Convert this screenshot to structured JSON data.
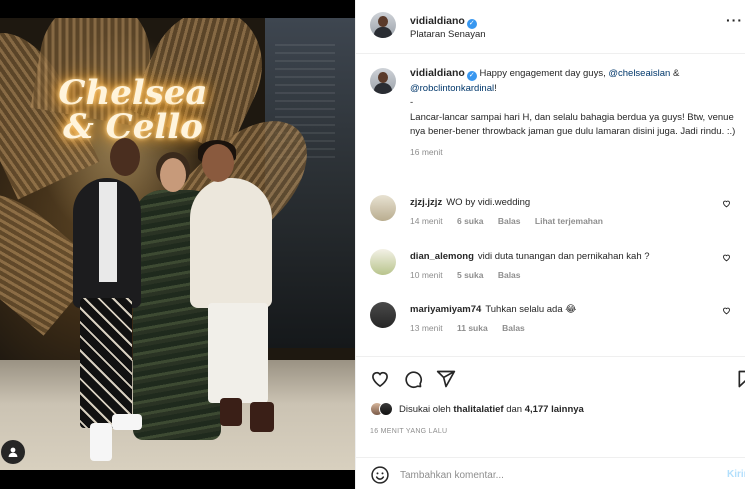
{
  "post": {
    "username": "vidialdiano",
    "location": "Plataran Senayan",
    "neon_sign": "Chelsea & Cello"
  },
  "caption": {
    "username": "vidialdiano",
    "text_1": "Happy engagement day guys,",
    "mention_1": "@chelseaislan",
    "amp": "&",
    "mention_2": "@robclintonkardinal",
    "text_2": "!",
    "dash": "-",
    "body": "Lancar-lancar sampai hari H, dan selalu bahagia berdua ya guys! Btw, venue nya bener-bener throwback jaman gue dulu lamaran disini juga. Jadi rindu. :.)",
    "time": "16 menit"
  },
  "comments": [
    {
      "username": "zjzj.jzjz",
      "text": "WO by vidi.wedding",
      "time": "14 menit",
      "likes": "6 suka",
      "reply": "Balas",
      "translate": "Lihat terjemahan"
    },
    {
      "username": "dian_alemong",
      "text": "vidi duta tunangan dan pernikahan kah ?",
      "time": "10 menit",
      "likes": "5 suka",
      "reply": "Balas"
    },
    {
      "username": "mariyamiyam74",
      "text": "Tuhkan selalu ada",
      "emoji": "😂",
      "time": "13 menit",
      "likes": "11 suka",
      "reply": "Balas"
    }
  ],
  "likes": {
    "prefix": "Disukai oleh",
    "liker": "thalitalatief",
    "middle": "dan",
    "others": "4,177 lainnya"
  },
  "timestamp": "16 MENIT YANG LALU",
  "comment_input": {
    "placeholder": "Tambahkan komentar...",
    "post_label": "Kirim"
  },
  "colors": {
    "link": "#00376b",
    "verified": "#3897f0",
    "muted": "#8e8e8e",
    "post_button": "#b2dffc"
  },
  "icons": [
    "verified-icon",
    "more-options-icon",
    "heart-icon",
    "comment-icon",
    "share-icon",
    "save-icon",
    "emoji-icon",
    "user-tag-icon"
  ]
}
